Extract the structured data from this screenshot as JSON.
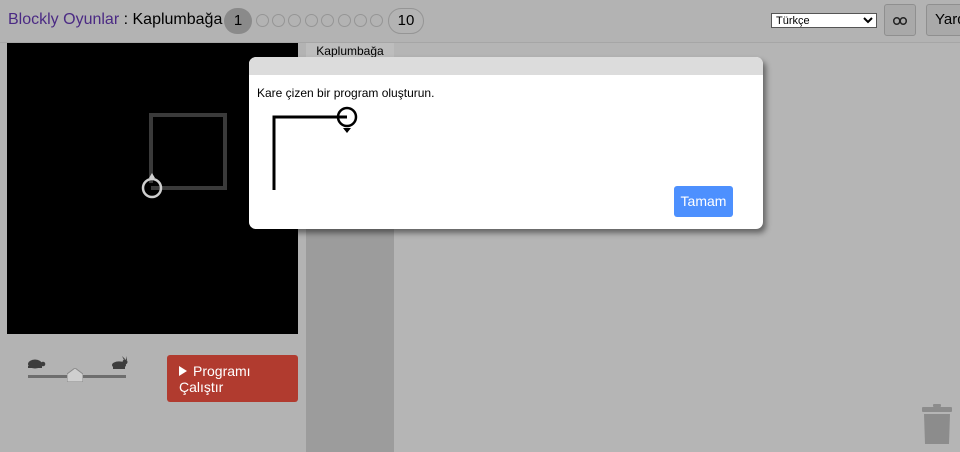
{
  "header": {
    "app_link": "Blockly Oyunlar",
    "separator": " : ",
    "game_name": "Kaplumbağa",
    "current_level": "1",
    "last_level": "10",
    "language_selected": "Türkçe",
    "help_label": "Yard"
  },
  "run_button": {
    "label": "Programı\nÇalıştır"
  },
  "speed_slider": {
    "value_fraction": 0.48
  },
  "toolbox": {
    "category_label": "Kaplumbağa"
  },
  "dialog": {
    "message": "Kare çizen bir program oluşturun.",
    "ok_label": "Tamam"
  },
  "icons": [
    "link-icon",
    "turtle-icon",
    "rabbit-icon",
    "play-icon",
    "trash-icon",
    "turtle-cursor-icon"
  ],
  "colors": {
    "title_link": "#4b2a84",
    "run_button": "#b13b2f",
    "ok_button": "#4d90fe",
    "canvas": "#000000"
  }
}
